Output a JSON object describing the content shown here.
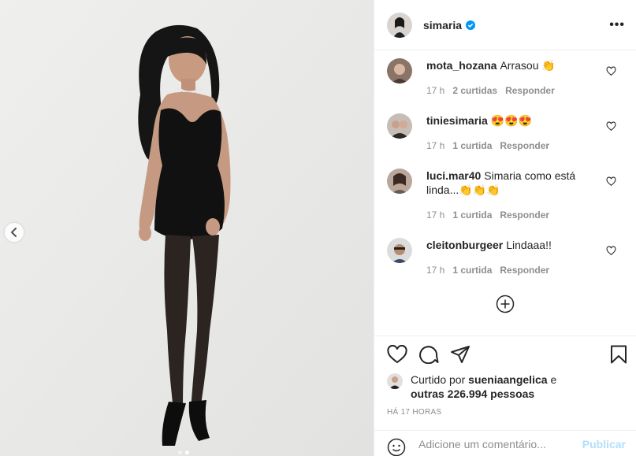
{
  "post": {
    "username": "simaria",
    "more_label": "•••",
    "icons": {
      "verified": "verified-badge-icon",
      "more": "more-options-icon",
      "prev": "chevron-left-icon",
      "heart": "heart-icon",
      "comment": "comment-icon",
      "share": "paper-plane-icon",
      "save": "bookmark-icon",
      "add": "plus-circle-icon",
      "emoji": "emoji-icon"
    }
  },
  "comments": [
    {
      "user": "mota_hozana",
      "text": "Arrasou 👏",
      "time": "17 h",
      "likes": "2 curtidas",
      "reply": "Responder"
    },
    {
      "user": "tiniesimaria",
      "text": "😍😍😍",
      "time": "17 h",
      "likes": "1 curtida",
      "reply": "Responder"
    },
    {
      "user": "luci.mar40",
      "text": "Simaria como está linda...👏👏👏",
      "time": "17 h",
      "likes": "1 curtida",
      "reply": "Responder"
    },
    {
      "user": "cleitonburgeer",
      "text": "Lindaaa!!",
      "time": "17 h",
      "likes": "1 curtida",
      "reply": "Responder"
    }
  ],
  "likes": {
    "prefix": "Curtido por",
    "user": "sueniaangelica",
    "conj": "e",
    "others": "outras 226.994 pessoas"
  },
  "time_ago": "HÁ 17 HORAS",
  "add_comment": {
    "placeholder": "Adicione um comentário...",
    "publish": "Publicar"
  },
  "colors": {
    "accent": "#0095f6",
    "publish_disabled": "#b2dffc",
    "meta": "#8e8e8e",
    "border": "#efefef"
  },
  "carousel": {
    "count": 2,
    "active": 2
  }
}
